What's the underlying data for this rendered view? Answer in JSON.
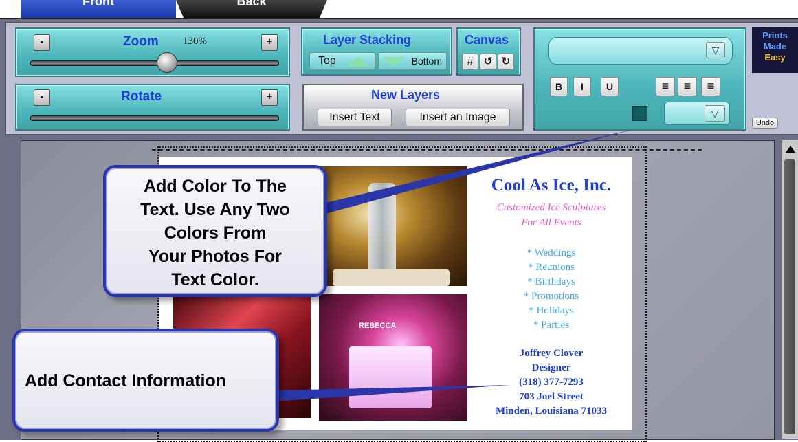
{
  "tabs": {
    "front": "Front",
    "back": "Back"
  },
  "zoom": {
    "title": "Zoom",
    "value": "130%",
    "minus": "-",
    "plus": "+",
    "level": 0.55
  },
  "rotate": {
    "title": "Rotate",
    "minus": "-",
    "plus": "+"
  },
  "layer_stacking": {
    "title": "Layer Stacking",
    "top": "Top",
    "bottom": "Bottom"
  },
  "canvas": {
    "title": "Canvas"
  },
  "new_layers": {
    "title": "New Layers",
    "insert_text": "Insert Text",
    "insert_image": "Insert an Image"
  },
  "text_format": {
    "bold": "B",
    "italic": "I",
    "underline": "U",
    "color_swatch": "#0f5d5f"
  },
  "brand": {
    "line1": "Prints",
    "line2": "Made",
    "line3": "Easy"
  },
  "undo": "Undo",
  "card": {
    "company": "Cool As Ice, Inc.",
    "tagline1": "Customized Ice Sculptures",
    "tagline2": "For All Events",
    "services": [
      "* Weddings",
      "* Reunions",
      "* Birthdays",
      "* Promotions",
      "* Holidays",
      "* Parties"
    ],
    "contact": [
      "Joffrey Clover",
      "Designer",
      "(318) 377-7293",
      "703 Joel Street",
      "Minden, Louisiana 71033"
    ],
    "photo_sign": "REBECCA"
  },
  "callouts": {
    "color": [
      "Add Color To The",
      "Text. Use Any Two",
      "Colors From",
      "Your Photos For",
      "Text Color."
    ],
    "contact": "Add Contact Information"
  },
  "colors": {
    "accent_blue": "#1f3fd6",
    "teal": "#4fb8bc",
    "callout_border": "#2b37a8"
  }
}
